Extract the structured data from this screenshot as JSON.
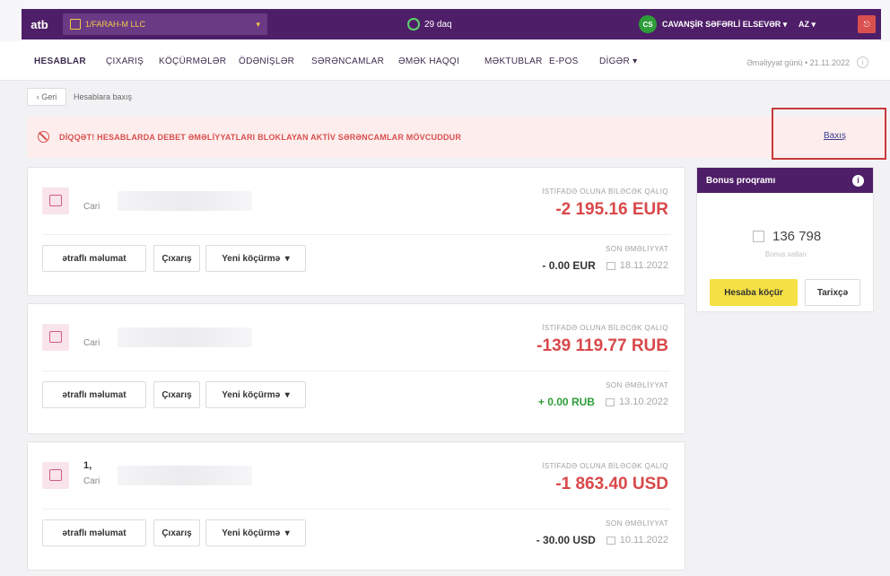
{
  "header": {
    "logo": "atb",
    "company": "1/FARAH-M LLC",
    "timer": "29 daq",
    "user_initials": "CS",
    "user_name": "CAVANŞİR SƏFƏRLİ ELSEVƏR",
    "language": "AZ"
  },
  "nav": {
    "items": [
      "HESABLAR",
      "ÇIXARIŞ",
      "KÖÇÜRMƏLƏR",
      "ÖDƏNİŞLƏR",
      "SƏRƏNCAMLAR",
      "ƏMƏK HAQQI",
      "MƏKTUBLAR",
      "E-POS",
      "DİGƏR"
    ],
    "operation_day": "Əməliyyat günü • 21.11.2022"
  },
  "breadcrumb": {
    "back": "Geri",
    "current": "Hesablara baxış"
  },
  "alert": {
    "text": "DİQQƏT! HESABLARDA DEBET ƏMƏLİYYATLARI BLOKLAYAN AKTİV SƏRƏNCAMLAR MÖVCUDDUR",
    "link": "Baxış"
  },
  "accounts": [
    {
      "number": "",
      "type": "Cari",
      "available_label": "İSTİFADƏ OLUNA BİLƏCƏK QALIQ",
      "available": "-2 195.16 EUR",
      "last_label": "SON ƏMƏLİYYAT",
      "last_amount": "- 0.00 EUR",
      "last_date": "18.11.2022"
    },
    {
      "number": "",
      "type": "Cari",
      "available_label": "İSTİFADƏ OLUNA BİLƏCƏK QALIQ",
      "available": "-139 119.77 RUB",
      "last_label": "SON ƏMƏLİYYAT",
      "last_amount": "+ 0.00 RUB",
      "last_date": "13.10.2022"
    },
    {
      "number": "1,",
      "type": "Cari",
      "available_label": "İSTİFADƏ OLUNA BİLƏCƏK QALIQ",
      "available": "-1 863.40 USD",
      "last_label": "SON ƏMƏLİYYAT",
      "last_amount": "- 30.00 USD",
      "last_date": "10.11.2022"
    }
  ],
  "account_buttons": {
    "details": "ətraflı məlumat",
    "statement": "Çıxarış",
    "new_transfer": "Yeni köçürmə"
  },
  "bonus": {
    "title": "Bonus proqramı",
    "points": "136 798",
    "points_label": "Bonus xalları",
    "transfer": "Hesaba köçür",
    "history": "Tarixçə"
  },
  "colors": {
    "brand_purple": "#4f1e68",
    "negative": "#d9484a",
    "positive": "#2e9d3a",
    "accent_yellow": "#f5e045"
  }
}
